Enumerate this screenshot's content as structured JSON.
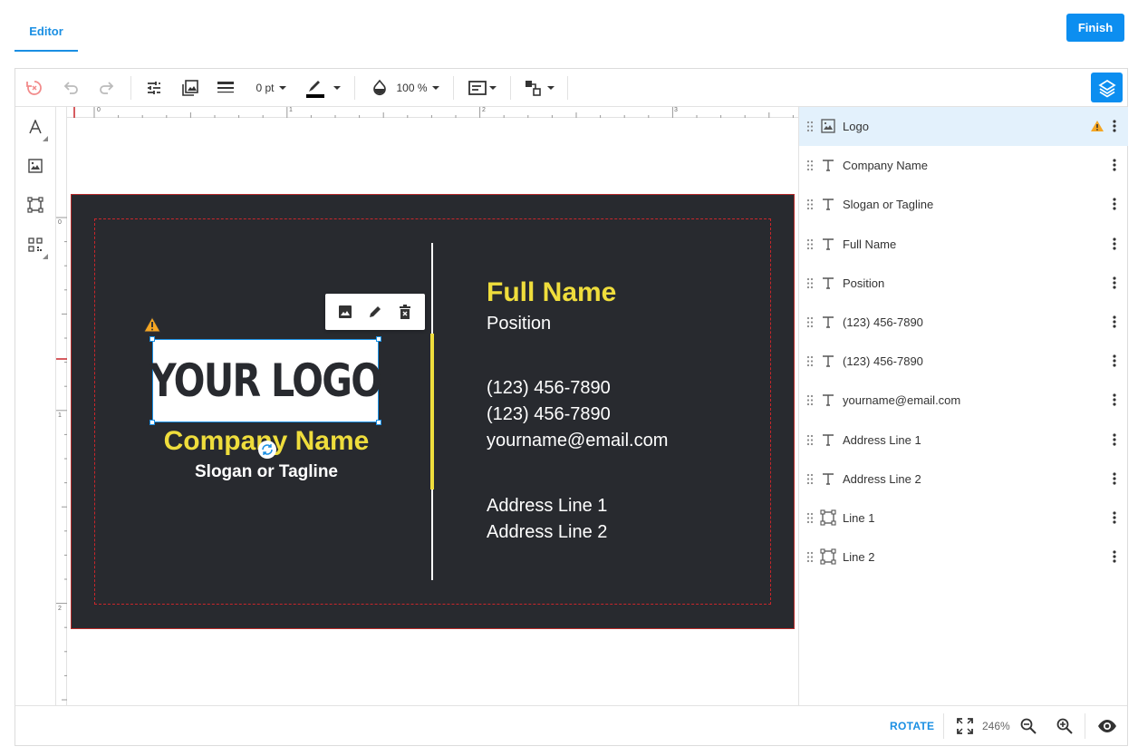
{
  "header": {
    "tab_editor": "Editor",
    "finish_label": "Finish"
  },
  "toolbar": {
    "stroke_width": "0 pt",
    "opacity": "100 %"
  },
  "ruler": {
    "h_ticks": [
      "0",
      "1",
      "2",
      "3"
    ],
    "v_ticks": [
      "0",
      "1",
      "2"
    ]
  },
  "card": {
    "logo_text": "YOUR LOGO",
    "company_name": "Company Name",
    "slogan": "Slogan or Tagline",
    "full_name": "Full Name",
    "position": "Position",
    "phone1": "(123) 456-7890",
    "phone2": "(123) 456-7890",
    "email": "yourname@email.com",
    "address1": "Address Line 1",
    "address2": "Address Line 2",
    "background_color": "#282a2f",
    "accent_color": "#efdd3c"
  },
  "layers": [
    {
      "name": "Logo",
      "type": "image",
      "warning": true,
      "active": true
    },
    {
      "name": "Company Name",
      "type": "text"
    },
    {
      "name": "Slogan or Tagline",
      "type": "text"
    },
    {
      "name": "Full Name",
      "type": "text"
    },
    {
      "name": "Position",
      "type": "text"
    },
    {
      "name": "(123) 456-7890",
      "type": "text"
    },
    {
      "name": "(123) 456-7890",
      "type": "text"
    },
    {
      "name": "yourname@email.com",
      "type": "text"
    },
    {
      "name": "Address Line 1",
      "type": "text"
    },
    {
      "name": "Address Line 2",
      "type": "text"
    },
    {
      "name": "Line 1",
      "type": "shape"
    },
    {
      "name": "Line 2",
      "type": "shape"
    }
  ],
  "footer": {
    "rotate_label": "ROTATE",
    "zoom_level": "246%"
  },
  "colors": {
    "primary": "#0c8ef0",
    "warning": "#f5a623"
  }
}
